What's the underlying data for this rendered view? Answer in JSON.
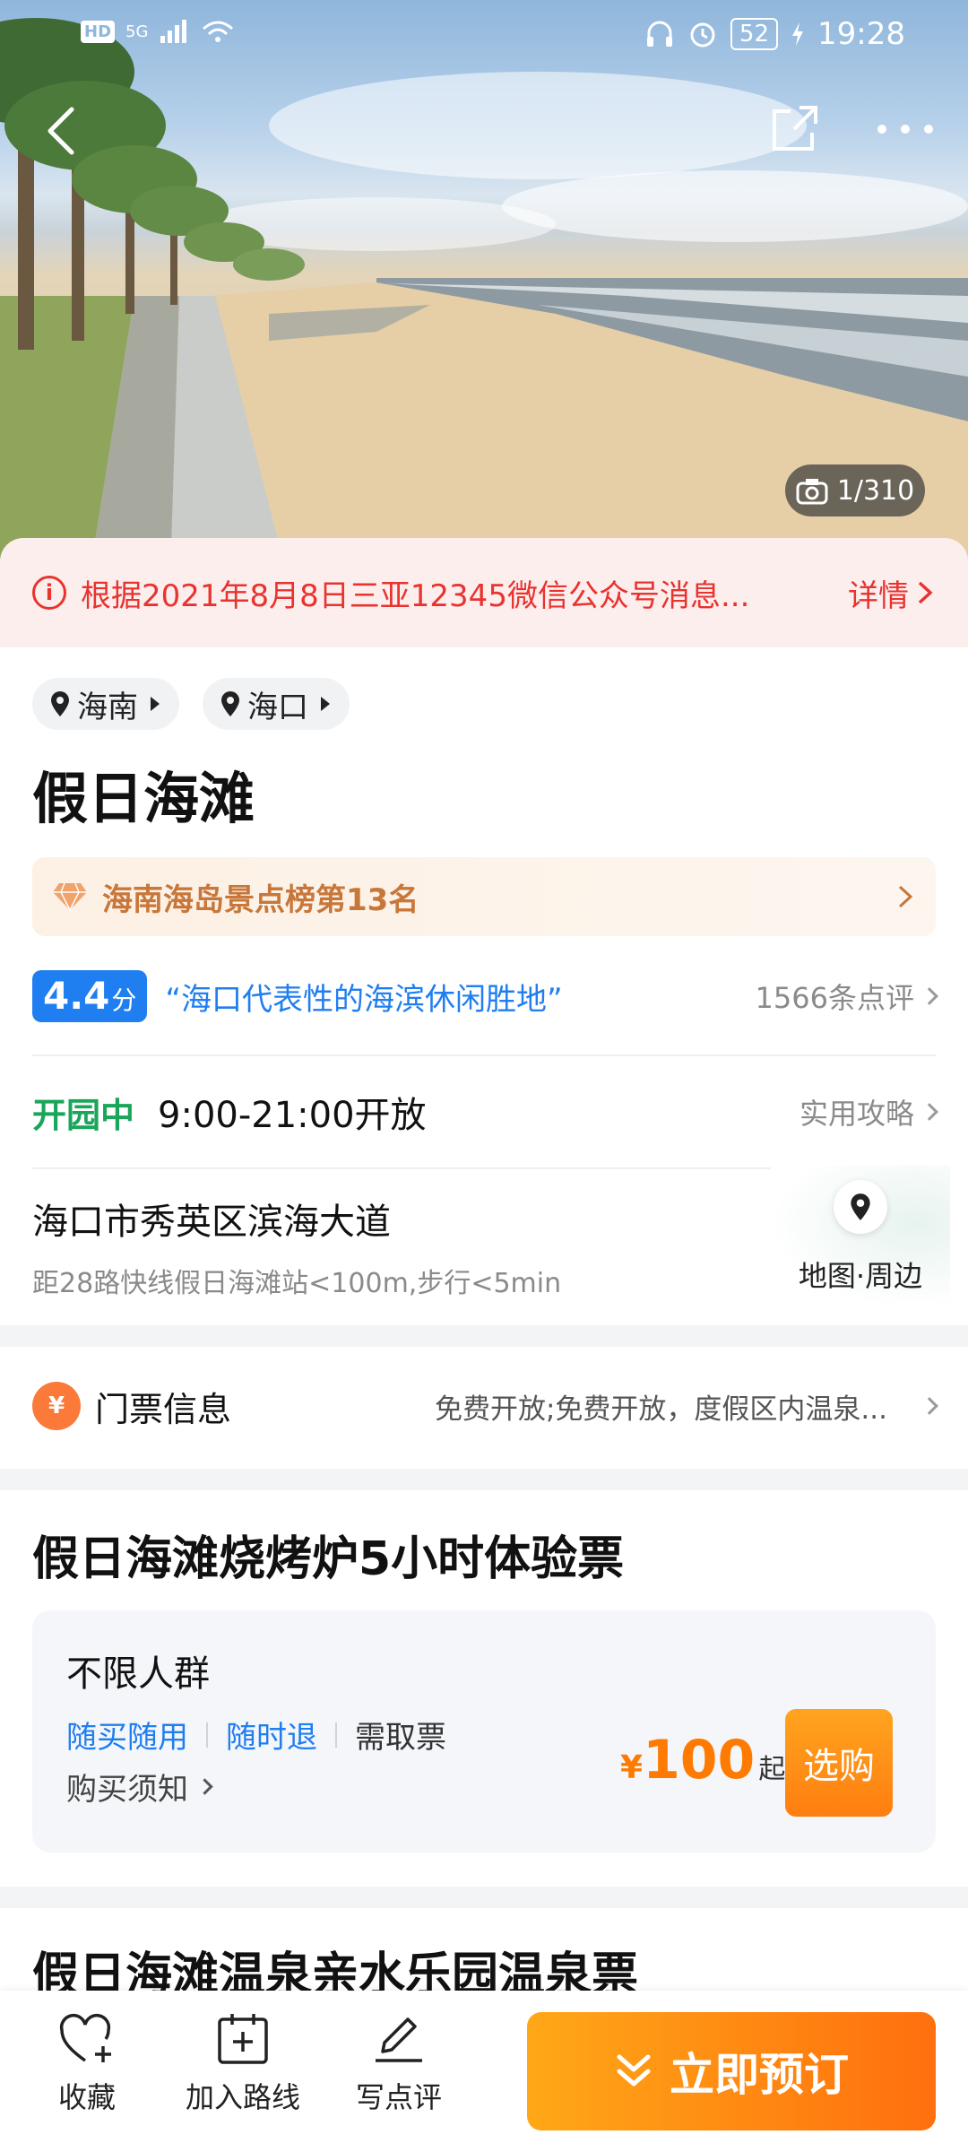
{
  "status_bar": {
    "hd": "HD",
    "network": "5G",
    "battery": "52",
    "time": "19:28"
  },
  "hero": {
    "photo_counter": "1/310"
  },
  "notice": {
    "text": "根据2021年8月8日三亚12345微信公众号消息...",
    "detail_label": "详情"
  },
  "location_chips": [
    {
      "label": "海南"
    },
    {
      "label": "海口"
    }
  ],
  "attraction": {
    "title": "假日海滩",
    "rank_text": "海南海岛景点榜第13名",
    "score": "4.4",
    "score_unit": "分",
    "quote": "“海口代表性的海滨休闲胜地”",
    "review_count": "1566条点评",
    "open_status": "开园中",
    "hours": "9:00-21:00开放",
    "guide_label": "实用攻略",
    "address": "海口市秀英区滨海大道",
    "address_sub": "距28路快线假日海滩站<100m,步行<5min",
    "map_label": "地图·周边"
  },
  "ticket_info": {
    "icon_text": "¥",
    "label": "门票信息",
    "description": "免费开放;免费开放，度假区内温泉..."
  },
  "products": [
    {
      "title": "假日海滩烧烤炉5小时体验票",
      "audience": "不限人群",
      "tags_blue": [
        "随买随用",
        "随时退"
      ],
      "tag_gray": "需取票",
      "buy_notice": "购买须知",
      "price_currency": "¥",
      "price": "100",
      "price_suffix": "起",
      "buy_label": "选购"
    },
    {
      "title": "假日海滩温泉亲水乐园温泉票"
    }
  ],
  "bottom_bar": {
    "favorite": "收藏",
    "add_route": "加入路线",
    "review": "写点评",
    "book": "立即预订"
  },
  "colors": {
    "accent_blue": "#1f7ef0",
    "open_green": "#1aa55a",
    "notice_red": "#e8332f",
    "price_orange": "#ff7a00",
    "rank_brown": "#c8773a"
  }
}
